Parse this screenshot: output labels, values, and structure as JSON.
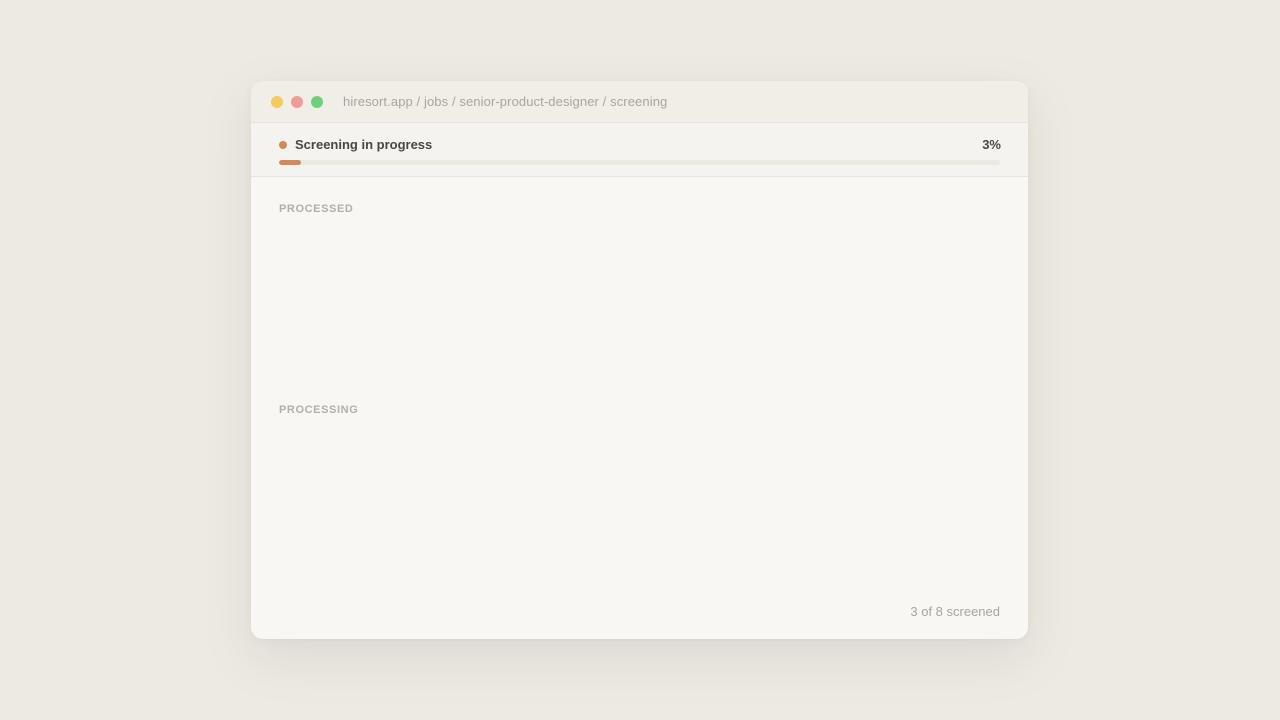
{
  "window": {
    "url": "hiresort.app / jobs / senior-product-designer / screening",
    "traffic_lights": [
      {
        "name": "minimize",
        "color": "#f4c95d"
      },
      {
        "name": "close",
        "color": "#f19a9a"
      },
      {
        "name": "maximize",
        "color": "#6fcf7c"
      }
    ]
  },
  "progress": {
    "status_label": "Screening in progress",
    "status_color": "#d08a5b",
    "percent_label": "3%",
    "percent_value": 3,
    "fill_color": "#d08a5b"
  },
  "sections": {
    "processed_label": "PROCESSED",
    "processing_label": "PROCESSING"
  },
  "footer": {
    "count_label": "3 of 8 screened"
  }
}
